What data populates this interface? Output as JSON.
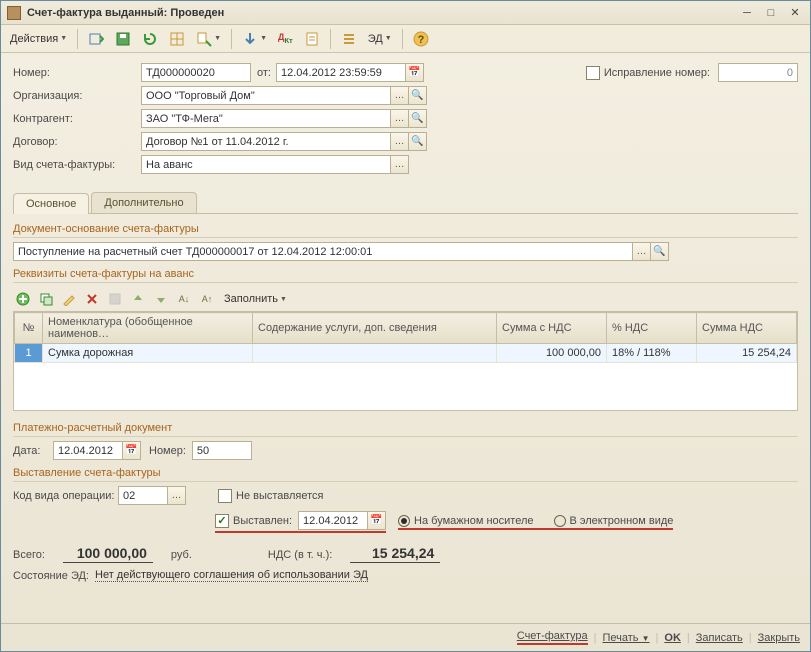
{
  "window": {
    "title": "Счет-фактура выданный: Проведен"
  },
  "toolbar": {
    "actions": "Действия",
    "ed": "ЭД"
  },
  "hdr": {
    "number_label": "Номер:",
    "number": "ТД000000020",
    "from": "от:",
    "date": "12.04.2012 23:59:59",
    "org_label": "Организация:",
    "org": "ООО \"Торговый Дом\"",
    "ca_label": "Контрагент:",
    "ca": "ЗАО \"ТФ-Мега\"",
    "contract_label": "Договор:",
    "contract": "Договор №1 от 11.04.2012 г.",
    "kind_label": "Вид счета-фактуры:",
    "kind": "На аванс",
    "correction_label": "Исправление номер:",
    "correction_number": "0"
  },
  "tabs": {
    "main": "Основное",
    "extra": "Дополнительно"
  },
  "section": {
    "basis": "Документ-основание счета-фактуры",
    "basis_doc": "Поступление на расчетный счет ТД000000017 от 12.04.2012 12:00:01",
    "requisites": "Реквизиты счета-фактуры на аванс",
    "fill": "Заполнить",
    "payment": "Платежно-расчетный документ",
    "payment_date_label": "Дата:",
    "payment_date": "12.04.2012",
    "payment_num_label": "Номер:",
    "payment_num": "50",
    "issuance": "Выставление счета-фактуры",
    "opcode_label": "Код вида операции:",
    "opcode": "02",
    "not_issued": "Не выставляется",
    "issued": "Выставлен:",
    "issued_date": "12.04.2012",
    "paper": "На бумажном носителе",
    "electronic": "В электронном виде",
    "grid": {
      "cols": {
        "num": "№",
        "nomen": "Номенклатура (обобщенное наименов…",
        "content": "Содержание услуги, доп. сведения",
        "sum_nds": "Сумма с НДС",
        "pct_nds": "% НДС",
        "amt_nds": "Сумма НДС"
      },
      "rows": [
        {
          "n": "1",
          "nomen": "Сумка дорожная",
          "content": "",
          "sum": "100 000,00",
          "pct": "18% / 118%",
          "nds": "15 254,24"
        }
      ]
    }
  },
  "totals": {
    "total_label": "Всего:",
    "total": "100 000,00",
    "currency": "руб.",
    "nds_label": "НДС (в т. ч.):",
    "nds": "15 254,24",
    "state_label": "Состояние ЭД:",
    "state": "Нет действующего соглашения об использовании ЭД"
  },
  "footer": {
    "invoice": "Счет-фактура",
    "print": "Печать",
    "ok": "OK",
    "save": "Записать",
    "close": "Закрыть"
  }
}
